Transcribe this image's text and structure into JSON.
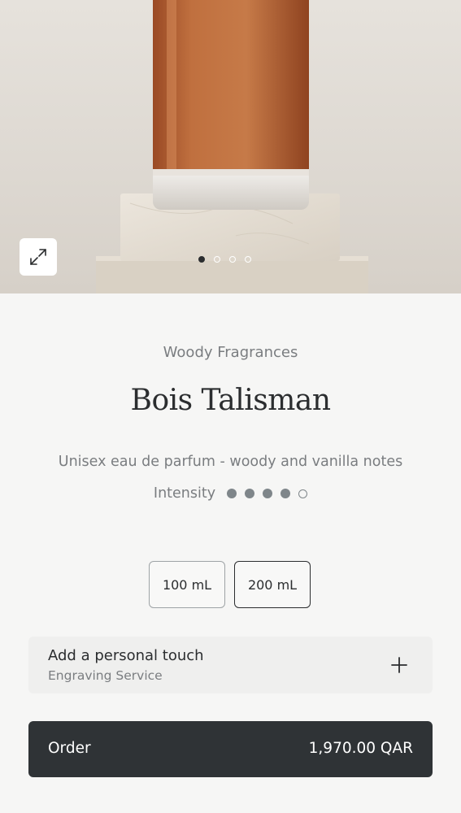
{
  "gallery": {
    "slide_count": 4,
    "active_slide": 1,
    "expand_icon": "expand-arrows-icon"
  },
  "product": {
    "category": "Woody Fragrances",
    "name": "Bois Talisman",
    "description": "Unisex eau de parfum - woody and vanilla notes",
    "intensity_label": "Intensity",
    "intensity_level": 4,
    "intensity_max": 5
  },
  "sizes": {
    "options": [
      "100 mL",
      "200 mL"
    ],
    "selected": "200 mL"
  },
  "engraving": {
    "title": "Add a personal touch",
    "subtitle": "Engraving Service",
    "icon": "plus-icon"
  },
  "order": {
    "label": "Order",
    "price": "1,970.00 QAR"
  },
  "colors": {
    "background": "#f6f6f5",
    "text_primary": "#2b2d2f",
    "text_secondary": "#7a7d80",
    "order_button": "#2f3336",
    "liquid": "#b5653a"
  }
}
